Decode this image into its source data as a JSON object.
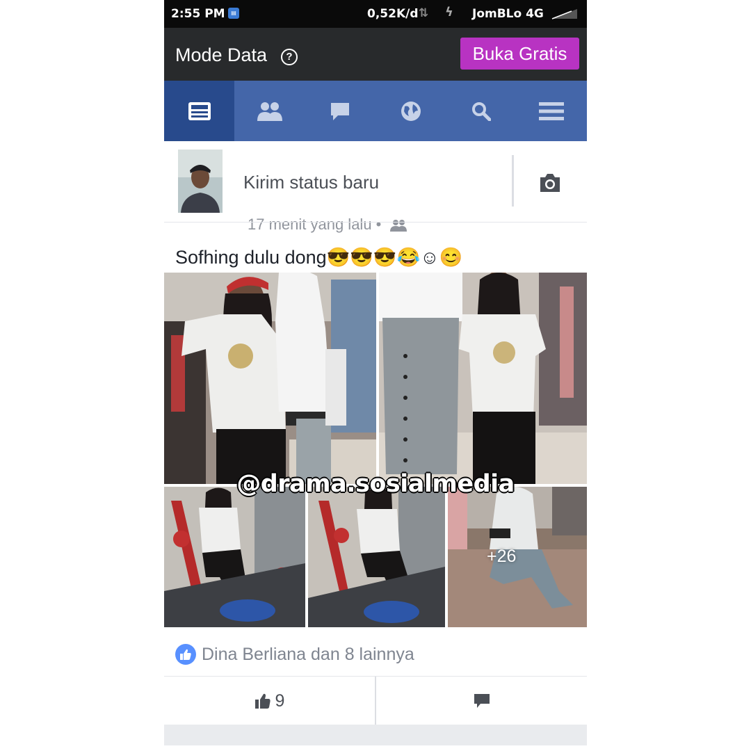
{
  "status_bar": {
    "time": "2:55 PM",
    "data_speed": "0,52K/d",
    "carrier": "JomBLo 4G"
  },
  "mode_bar": {
    "title": "Mode Data",
    "help_glyph": "?",
    "buka_label": "Buka Gratis"
  },
  "nav": {
    "items": [
      {
        "icon": "news-feed-icon",
        "active": true
      },
      {
        "icon": "friends-icon",
        "active": false
      },
      {
        "icon": "messages-icon",
        "active": false
      },
      {
        "icon": "globe-icon",
        "active": false
      },
      {
        "icon": "search-icon",
        "active": false
      },
      {
        "icon": "menu-icon",
        "active": false
      }
    ]
  },
  "composer": {
    "placeholder": "Kirim status baru",
    "camera_icon": "camera-icon"
  },
  "post": {
    "meta": "17 menit yang lalu •",
    "text": "Sofhing dulu dong😎😎😎😂☺😊",
    "more_photos": "+26",
    "watermark": "@drama.sosialmedia",
    "likes_text": "Dina Berliana dan 8 lainnya",
    "like_count": "9"
  },
  "colors": {
    "facebook_blue": "#4466a9",
    "nav_active": "#284a8c",
    "buka_button": "#b833c2",
    "like_badge": "#5890ff"
  }
}
